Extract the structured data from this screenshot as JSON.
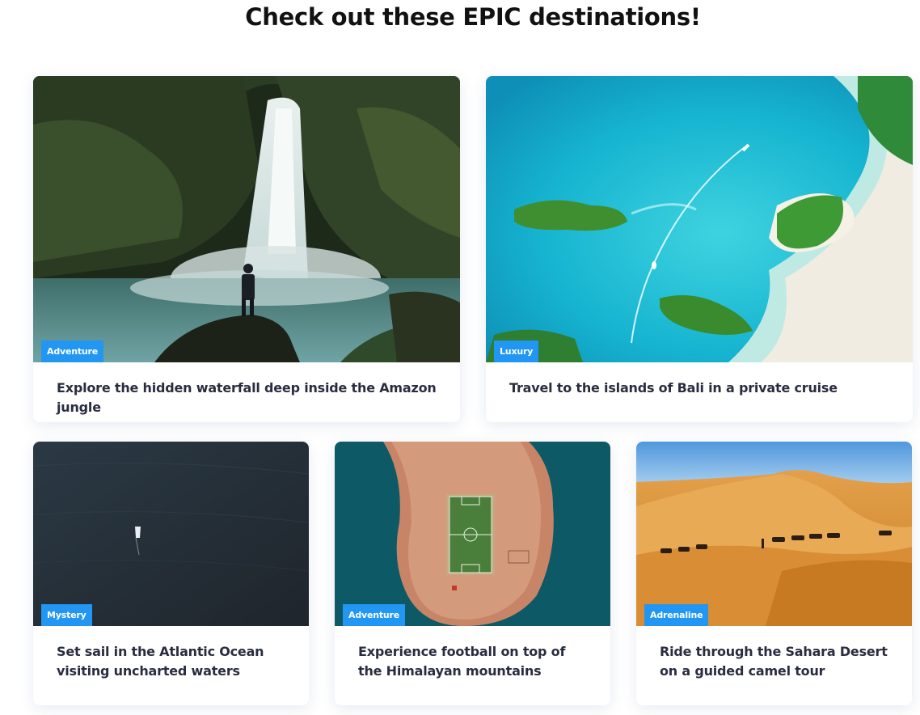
{
  "page": {
    "title": "Check out these EPIC destinations!"
  },
  "cards": [
    {
      "badge": "Adventure",
      "text": "Explore the hidden waterfall deep inside the Amazon jungle",
      "image": "waterfall-photo"
    },
    {
      "badge": "Luxury",
      "text": "Travel to the islands of Bali in a private cruise",
      "image": "islands-aerial-photo"
    },
    {
      "badge": "Mystery",
      "text": "Set sail in the Atlantic Ocean visiting uncharted waters",
      "image": "ocean-boat-photo"
    },
    {
      "badge": "Adventure",
      "text": "Experience football on top of the Himalayan mountains",
      "image": "island-football-field-photo"
    },
    {
      "badge": "Adrenaline",
      "text": "Ride through the Sahara Desert on a guided camel tour",
      "image": "desert-camels-photo"
    }
  ],
  "colors": {
    "badge": "#2196f3",
    "text": "#2a2d3f",
    "title": "#111111"
  }
}
